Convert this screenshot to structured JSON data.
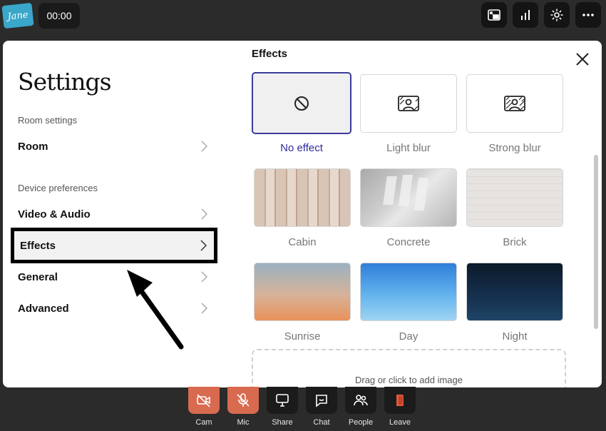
{
  "topbar": {
    "logo_text": "Jane",
    "timer": "00:00",
    "buttons": [
      {
        "icon": "picture-in-picture-icon"
      },
      {
        "icon": "signal-bars-icon"
      },
      {
        "icon": "gear-icon"
      },
      {
        "icon": "more-icon"
      }
    ]
  },
  "settings": {
    "title": "Settings",
    "sections": [
      {
        "label": "Room settings",
        "items": [
          "Room"
        ]
      },
      {
        "label": "Device preferences",
        "items": [
          "Video & Audio",
          "Effects",
          "General",
          "Advanced"
        ]
      }
    ],
    "active_item": "Effects"
  },
  "effects": {
    "heading": "Effects",
    "tiles": [
      {
        "label": "No effect",
        "icon": "no-effect-icon",
        "selected": true
      },
      {
        "label": "Light blur",
        "icon": "blur-icon"
      },
      {
        "label": "Strong blur",
        "icon": "blur-icon"
      },
      {
        "label": "Cabin"
      },
      {
        "label": "Concrete"
      },
      {
        "label": "Brick"
      },
      {
        "label": "Sunrise"
      },
      {
        "label": "Day"
      },
      {
        "label": "Night"
      }
    ],
    "drop_zone": "Drag or click to add image"
  },
  "toolbar": {
    "items": [
      {
        "label": "Cam",
        "icon": "camera-off-icon"
      },
      {
        "label": "Mic",
        "icon": "mic-off-icon"
      },
      {
        "label": "Share",
        "icon": "share-screen-icon"
      },
      {
        "label": "Chat",
        "icon": "chat-icon"
      },
      {
        "label": "People",
        "icon": "people-icon"
      },
      {
        "label": "Leave",
        "icon": "leave-icon"
      }
    ]
  },
  "colors": {
    "accent": "#3b3b9c",
    "toolbar_red": "#d86a50",
    "background": "#2b2b2b"
  }
}
